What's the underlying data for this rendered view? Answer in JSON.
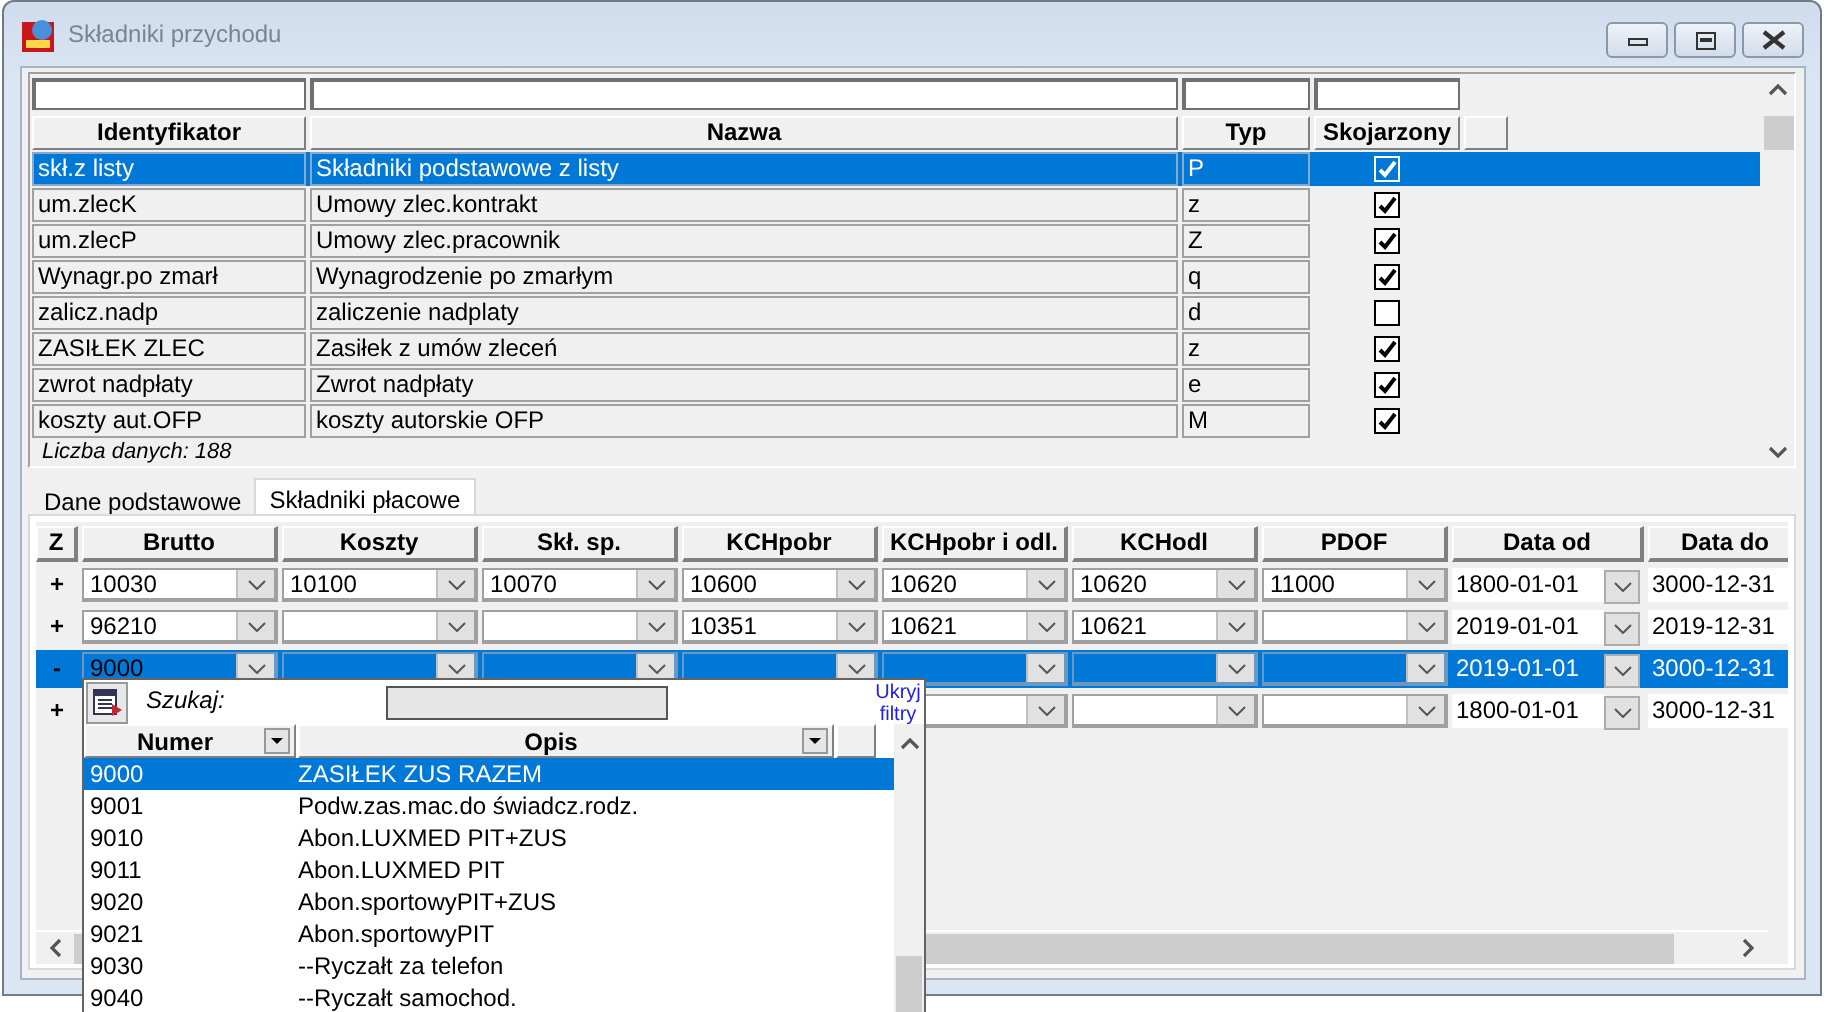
{
  "window": {
    "title": "Składniki przychodu"
  },
  "top_grid": {
    "columns": [
      "Identyfikator",
      "Nazwa",
      "Typ",
      "Skojarzony"
    ],
    "rows": [
      {
        "id": "skł.z listy",
        "name": "Składniki podstawowe z listy",
        "type": "P",
        "linked": true,
        "selected": true
      },
      {
        "id": "um.zlecK",
        "name": "Umowy zlec.kontrakt",
        "type": "z",
        "linked": true,
        "selected": false
      },
      {
        "id": "um.zlecP",
        "name": "Umowy zlec.pracownik",
        "type": "Z",
        "linked": true,
        "selected": false
      },
      {
        "id": "Wynagr.po zmarł",
        "name": "Wynagrodzenie po zmarłym",
        "type": "q",
        "linked": true,
        "selected": false
      },
      {
        "id": "zalicz.nadp",
        "name": "zaliczenie nadplaty",
        "type": "d",
        "linked": false,
        "selected": false
      },
      {
        "id": "ZASIŁEK ZLEC",
        "name": "Zasiłek z umów zleceń",
        "type": "z",
        "linked": true,
        "selected": false
      },
      {
        "id": "zwrot nadpłaty",
        "name": "Zwrot nadpłaty",
        "type": "e",
        "linked": true,
        "selected": false
      },
      {
        "id": "koszty aut.OFP",
        "name": "koszty autorskie OFP",
        "type": "M",
        "linked": true,
        "selected": false
      }
    ],
    "count_label": "Liczba danych: 188"
  },
  "tabs": [
    {
      "label": "Dane podstawowe",
      "selected": false
    },
    {
      "label": "Składniki płacowe",
      "selected": true
    }
  ],
  "components_grid": {
    "columns": [
      {
        "label": "Z",
        "kind": "marker"
      },
      {
        "label": "Brutto",
        "kind": "combo"
      },
      {
        "label": "Koszty",
        "kind": "combo"
      },
      {
        "label": "Skł. sp.",
        "kind": "combo"
      },
      {
        "label": "KCHpobr",
        "kind": "combo"
      },
      {
        "label": "KCHpobr i odl.",
        "kind": "combo"
      },
      {
        "label": "KCHodl",
        "kind": "combo"
      },
      {
        "label": "PDOF",
        "kind": "combo"
      },
      {
        "label": "Data od",
        "kind": "date_picker"
      },
      {
        "label": "Data do",
        "kind": "date"
      }
    ],
    "rows": [
      {
        "selected": false,
        "cells": [
          "+",
          "10030",
          "10100",
          "10070",
          "10600",
          "10620",
          "10620",
          "11000",
          "1800-01-01",
          "3000-12-31"
        ]
      },
      {
        "selected": false,
        "cells": [
          "+",
          "96210",
          null,
          null,
          "10351",
          "10621",
          "10621",
          null,
          "2019-01-01",
          "2019-12-31"
        ]
      },
      {
        "selected": true,
        "cells": [
          "-",
          "9000",
          null,
          null,
          null,
          null,
          null,
          null,
          "2019-01-01",
          "3000-12-31"
        ]
      },
      {
        "selected": false,
        "cells": [
          "+",
          false,
          false,
          false,
          false,
          null,
          null,
          null,
          "1800-01-01",
          "3000-12-31"
        ]
      }
    ]
  },
  "lookup_popup": {
    "search_label": "Szukaj:",
    "hide_filters_link": "Ukryj filtry",
    "columns": [
      "Numer",
      "Opis"
    ],
    "rows": [
      {
        "number": "9000",
        "description": "ZASIŁEK ZUS RAZEM",
        "selected": true
      },
      {
        "number": "9001",
        "description": "Podw.zas.mac.do świadcz.rodz.",
        "selected": false
      },
      {
        "number": "9010",
        "description": "Abon.LUXMED PIT+ZUS",
        "selected": false
      },
      {
        "number": "9011",
        "description": "Abon.LUXMED PIT",
        "selected": false
      },
      {
        "number": "9020",
        "description": "Abon.sportowyPIT+ZUS",
        "selected": false
      },
      {
        "number": "9021",
        "description": "Abon.sportowyPIT",
        "selected": false
      },
      {
        "number": "9030",
        "description": "--Ryczałt za telefon",
        "selected": false
      },
      {
        "number": "9040",
        "description": "--Ryczałt samochod.",
        "selected": false
      }
    ]
  }
}
